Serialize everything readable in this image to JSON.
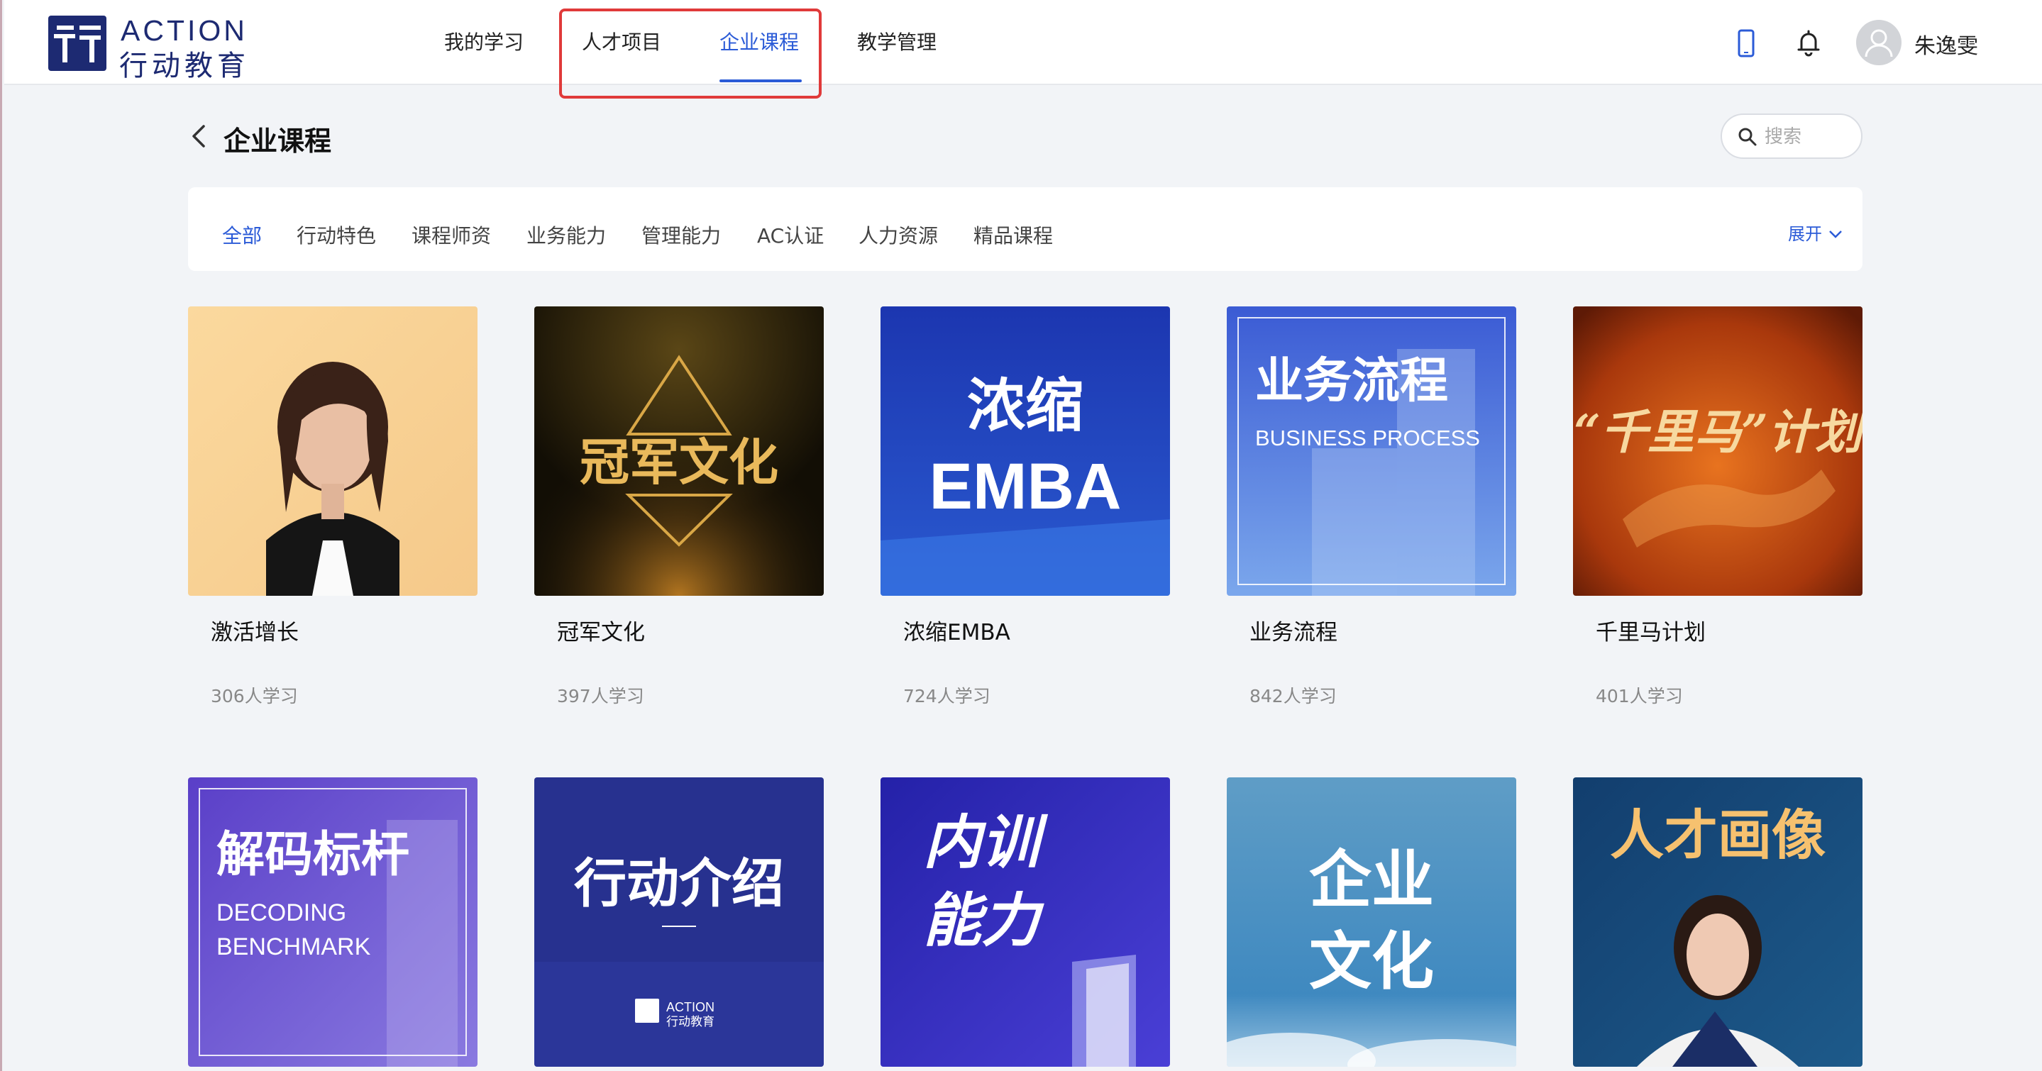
{
  "brand": {
    "en": "ACTION",
    "cn": "行动教育",
    "accent": "#1d2a72"
  },
  "nav": [
    {
      "label": "我的学习"
    },
    {
      "label": "人才项目"
    },
    {
      "label": "企业课程",
      "active": true
    },
    {
      "label": "教学管理"
    }
  ],
  "user": {
    "name": "朱逸雯"
  },
  "page": {
    "title": "企业课程"
  },
  "search": {
    "placeholder": "搜索"
  },
  "filters": {
    "items": [
      "全部",
      "行动特色",
      "课程师资",
      "业务能力",
      "管理能力",
      "AC认证",
      "人力资源",
      "精品课程"
    ],
    "active_index": 0,
    "expand_label": "展开"
  },
  "courses": [
    {
      "title": "激活增长",
      "learners": "306人学习",
      "cover": {}
    },
    {
      "title": "冠军文化",
      "learners": "397人学习",
      "cover": {
        "text": "冠军文化"
      }
    },
    {
      "title": "浓缩EMBA",
      "learners": "724人学习",
      "cover": {
        "line1": "浓缩",
        "line2": "EMBA"
      }
    },
    {
      "title": "业务流程",
      "learners": "842人学习",
      "cover": {
        "line1": "业务流程",
        "line2": "BUSINESS PROCESS"
      }
    },
    {
      "title": "千里马计划",
      "learners": "401人学习",
      "cover": {
        "text": "“千里马”计划"
      }
    },
    {
      "title": "",
      "learners": "",
      "cover": {
        "line1": "解码标杆",
        "line2": "DECODING",
        "line3": "BENCHMARK"
      }
    },
    {
      "title": "",
      "learners": "",
      "cover": {
        "text": "行动介绍",
        "logo_en": "ACTION",
        "logo_cn": "行动教育"
      }
    },
    {
      "title": "",
      "learners": "",
      "cover": {
        "line1": "内训",
        "line2": "能力"
      }
    },
    {
      "title": "",
      "learners": "",
      "cover": {
        "line1": "企业",
        "line2": "文化"
      }
    },
    {
      "title": "",
      "learners": "",
      "cover": {
        "text": "人才画像"
      }
    }
  ],
  "colors": {
    "active": "#2b5bd7",
    "highlight_box": "#e03a3a"
  }
}
